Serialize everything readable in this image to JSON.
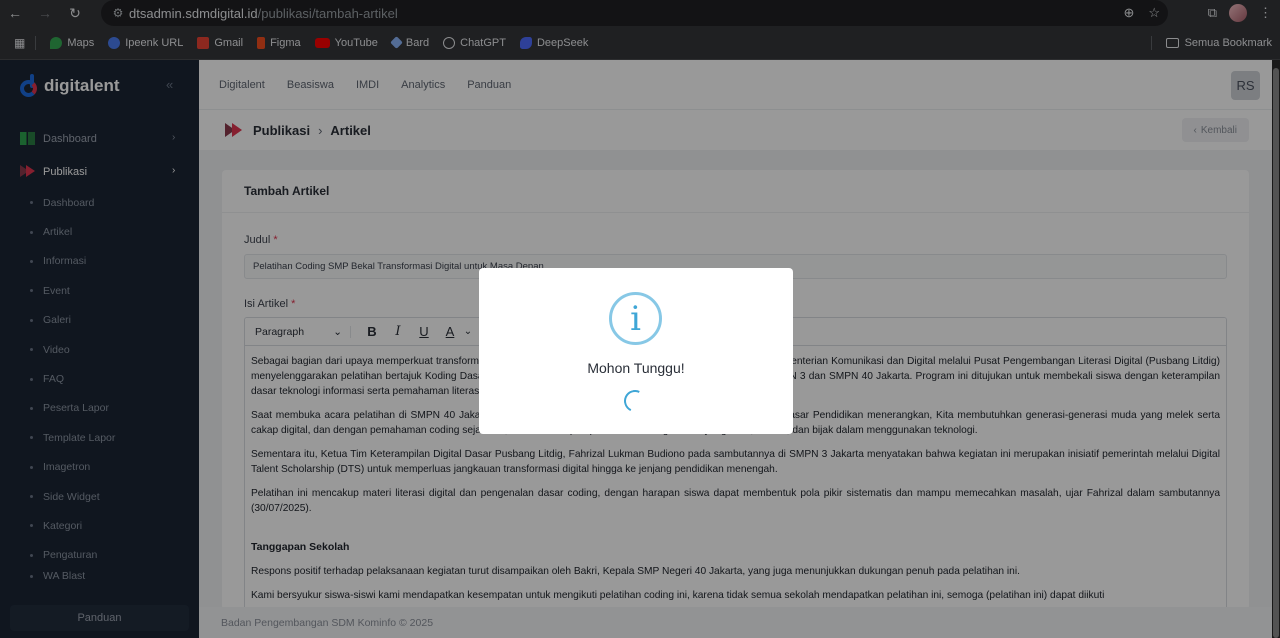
{
  "browser": {
    "url_host": "dtsadmin.sdmdigital.id",
    "url_path": "/publikasi/tambah-artikel",
    "bookmarks": [
      {
        "label": "Maps",
        "color": "#34a853"
      },
      {
        "label": "Ipeenk URL",
        "color": "#4a7cf0"
      },
      {
        "label": "Gmail",
        "color": "#ea4335"
      },
      {
        "label": "Figma",
        "color": "#f24e1e"
      },
      {
        "label": "YouTube",
        "color": "#ff0000"
      },
      {
        "label": "Bard",
        "color": "#8ab4f8"
      },
      {
        "label": "ChatGPT",
        "color": "#e8eaed"
      },
      {
        "label": "DeepSeek",
        "color": "#4d6bfe"
      }
    ],
    "all_bookmarks": "Semua Bookmark"
  },
  "sidebar": {
    "logo": "digitalent",
    "items": [
      {
        "label": "Dashboard"
      },
      {
        "label": "Publikasi"
      }
    ],
    "subitems": [
      "Dashboard",
      "Artikel",
      "Informasi",
      "Event",
      "Galeri",
      "Video",
      "FAQ",
      "Peserta Lapor",
      "Template Lapor",
      "Imagetron",
      "Side Widget",
      "Kategori",
      "Pengaturan",
      "WA Blast"
    ],
    "footer": "Panduan"
  },
  "topnav": {
    "items": [
      "Digitalent",
      "Beasiswa",
      "IMDI",
      "Analytics",
      "Panduan"
    ],
    "avatar": "RS"
  },
  "breadcrumb": {
    "parent": "Publikasi",
    "current": "Artikel",
    "back": "Kembali"
  },
  "form": {
    "title": "Tambah Artikel",
    "judul_label": "Judul",
    "judul_value": "Pelatihan Coding SMP Bekal Transformasi Digital untuk Masa Depan",
    "isi_label": "Isi Artikel",
    "toolbar_format": "Paragraph",
    "body": {
      "p1": "Sebagai bagian dari upaya memperkuat transformasi digital di sektor pendidikan, Digital Talent Scholarship (DTS) Kementerian Komunikasi dan Digital melalui Pusat Pengembangan Literasi Digital (Pusbang Litdig) menyelenggarakan pelatihan bertajuk Koding Dasar: Pengenalan Coding Untuk Siswa SMP/Sederajat Batch 2 di SMPN 3 dan SMPN 40 Jakarta. Program ini ditujukan untuk membekali siswa dengan keterampilan dasar teknologi informasi serta pemahaman literasi digital.",
      "p2": "Saat membuka acara pelatihan di SMPN 40 Jakarta, perwakilan Direktorat Jenderal Pendidikan Dasar Pendidikan Dasar Pendidikan menerangkan, Kita membutuhkan generasi-generasi muda yang melek serta cakap digital, dan dengan pemahaman coding sejak dini, kami berharap dapat membentuk generasi yang kritis, cerdas, dan bijak dalam menggunakan teknologi.",
      "p3": "Sementara itu, Ketua Tim Keterampilan Digital Dasar Pusbang Litdig, Fahrizal Lukman Budiono pada sambutannya di SMPN 3 Jakarta menyatakan bahwa kegiatan ini merupakan inisiatif pemerintah melalui Digital Talent Scholarship (DTS) untuk memperluas jangkauan transformasi digital hingga ke jenjang pendidikan menengah.",
      "p4": "Pelatihan ini mencakup materi literasi digital dan pengenalan dasar coding, dengan harapan siswa dapat membentuk pola pikir sistematis dan mampu memecahkan masalah, ujar Fahrizal dalam sambutannya (30/07/2025).",
      "h1": "Tanggapan Sekolah",
      "p5": "Respons positif terhadap pelaksanaan kegiatan turut disampaikan oleh Bakri, Kepala SMP Negeri 40 Jakarta, yang juga menunjukkan dukungan penuh pada pelatihan ini.",
      "p6": "Kami bersyukur siswa-siswi kami mendapatkan kesempatan untuk mengikuti pelatihan coding ini, karena tidak semua sekolah mendapatkan pelatihan ini, semoga (pelatihan ini) dapat diikuti"
    }
  },
  "footer": "Badan Pengembangan SDM Kominfo © 2025",
  "modal": {
    "icon": "i",
    "title": "Mohon Tunggu!"
  }
}
